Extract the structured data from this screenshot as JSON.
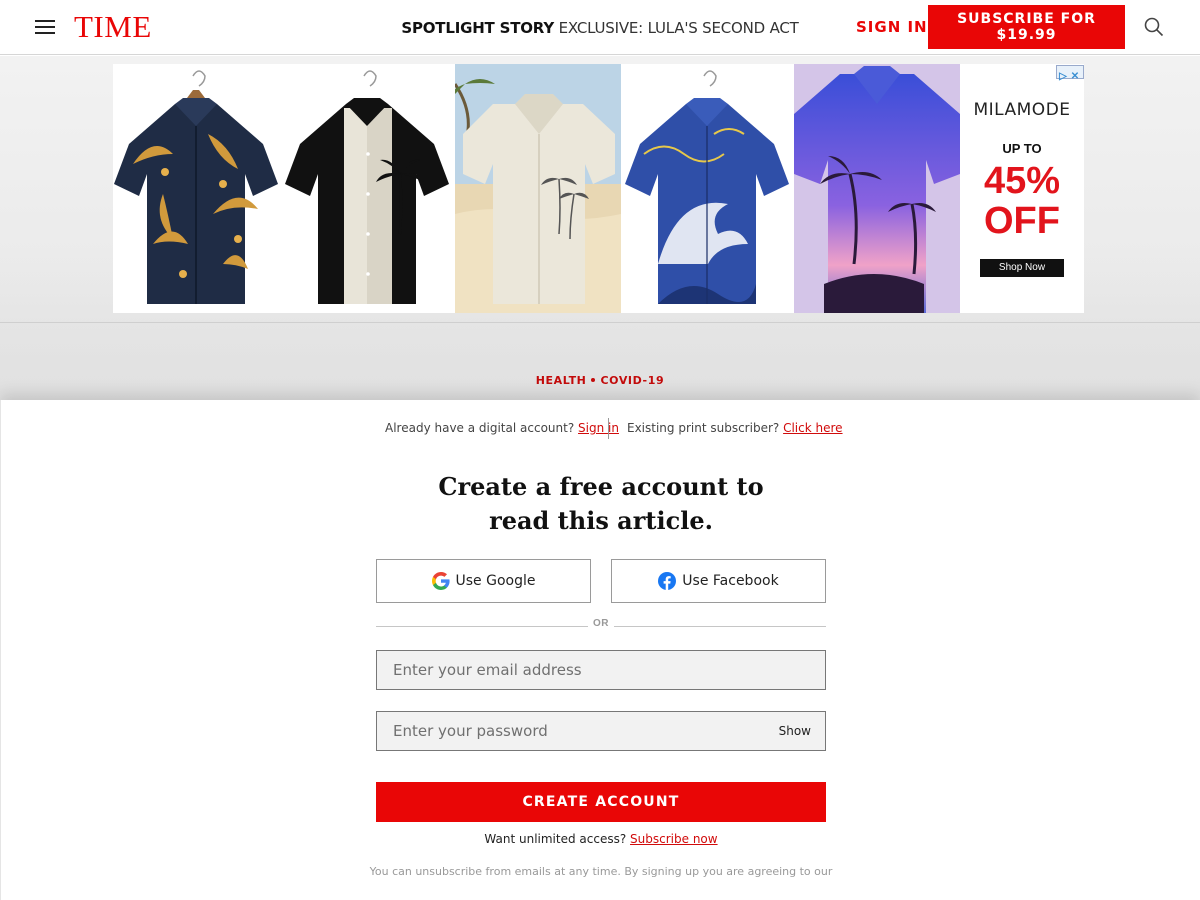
{
  "header": {
    "logo": "TIME",
    "spotlight_tag": "SPOTLIGHT STORY",
    "spotlight_title": "EXCLUSIVE: LULA'S SECOND ACT",
    "sign_in": "SIGN IN",
    "subscribe": "SUBSCRIBE FOR $19.99"
  },
  "ad": {
    "brand": "MILAMODE",
    "up_to": "UP TO",
    "discount": "45%",
    "off": "OFF",
    "shop_now": "Shop Now",
    "shirts": [
      "floral-navy-shirt",
      "black-white-palm-shirt",
      "cream-palm-shirt",
      "wave-print-shirt",
      "purple-sunset-palm-shirt"
    ]
  },
  "breadcrumb": {
    "section": "HEALTH",
    "topic": "COVID-19"
  },
  "paywall": {
    "digital_prompt": "Already have a digital account?",
    "digital_link": "Sign in",
    "print_prompt": "Existing print subscriber?",
    "print_link": "Click here",
    "heading_line1": "Create a free account to",
    "heading_line2": "read this article.",
    "google_label": "Use Google",
    "facebook_label": "Use Facebook",
    "or": "OR",
    "email_placeholder": "Enter your email address",
    "password_placeholder": "Enter your password",
    "show": "Show",
    "create_account": "CREATE ACCOUNT",
    "unlimited_prompt": "Want unlimited access?",
    "subscribe_link": "Subscribe now",
    "legal": "You can unsubscribe from emails at any time. By signing up you are agreeing to our"
  },
  "colors": {
    "brand_red": "#e90606",
    "link_red": "#d10b0b",
    "breadcrumb_red": "#c30b0b",
    "ad_red": "#e2141c"
  }
}
